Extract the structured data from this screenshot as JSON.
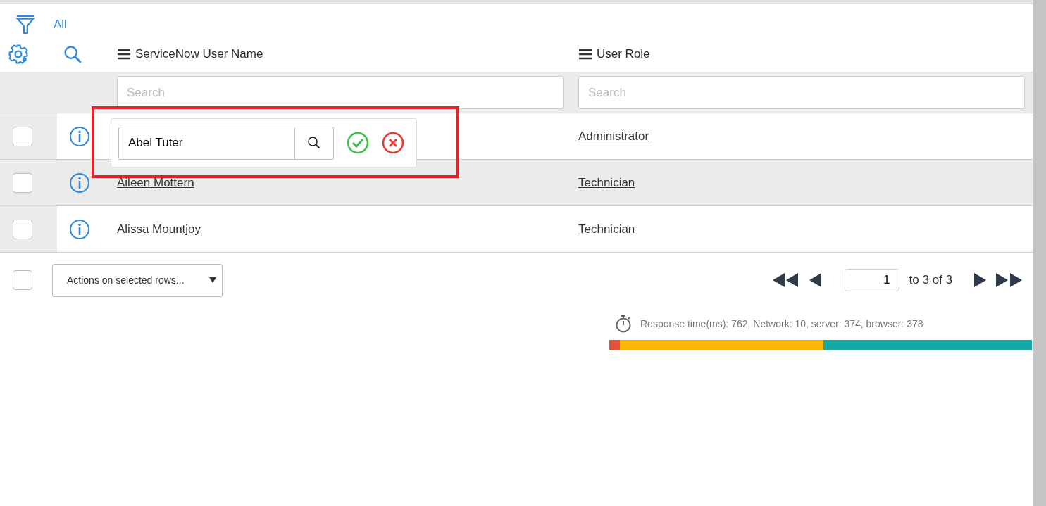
{
  "filter": {
    "label": "All"
  },
  "columns": [
    "ServiceNow User Name",
    "User Role"
  ],
  "column_search": [
    {
      "placeholder": "Search"
    },
    {
      "placeholder": "Search"
    }
  ],
  "rows": [
    {
      "role": "Administrator",
      "checked": false,
      "hovered": false
    },
    {
      "name": "Aileen Mottern",
      "role": "Technician",
      "checked": false,
      "hovered": true
    },
    {
      "name": "Alissa Mountjoy",
      "role": "Technician",
      "checked": false,
      "hovered": false
    }
  ],
  "inline_editor": {
    "value": "Abel Tuter"
  },
  "footer": {
    "select_all_checked": false,
    "actions": "Actions on selected rows...",
    "page": "1",
    "page_range": "to 3 of 3"
  },
  "response": {
    "text": "Response time(ms): 762, Network: 10, server: 374, browser: 378"
  }
}
